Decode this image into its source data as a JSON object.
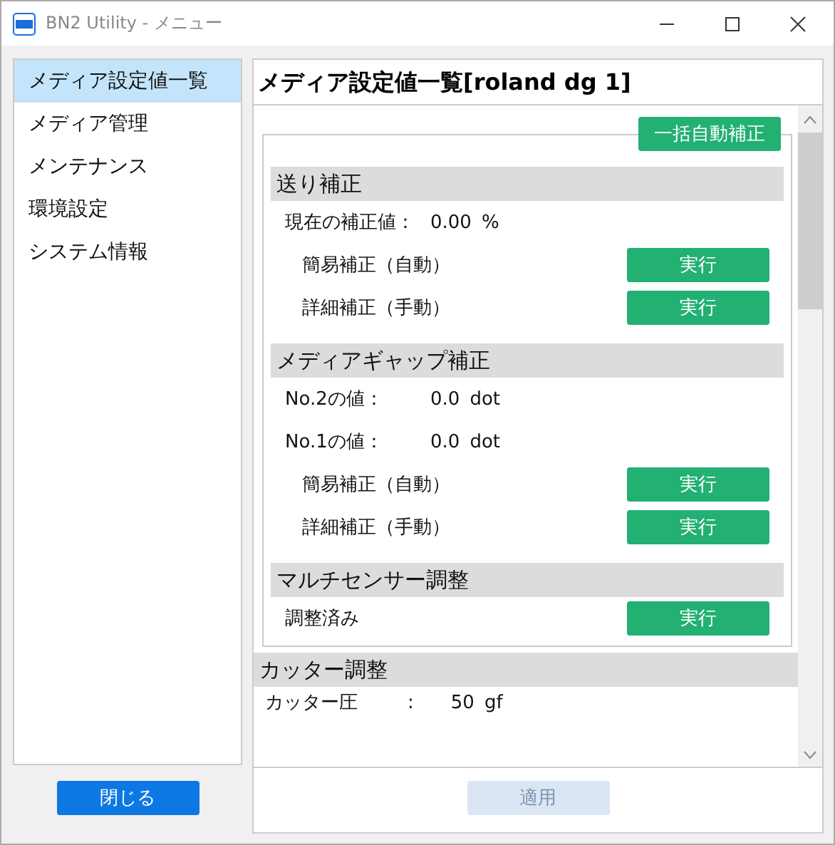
{
  "window": {
    "title": "BN2 Utility - メニュー"
  },
  "sidebar": {
    "items": [
      {
        "label": "メディア設定値一覧",
        "selected": true
      },
      {
        "label": "メディア管理",
        "selected": false
      },
      {
        "label": "メンテナンス",
        "selected": false
      },
      {
        "label": "環境設定",
        "selected": false
      },
      {
        "label": "システム情報",
        "selected": false
      }
    ]
  },
  "close_button": "閉じる",
  "panel": {
    "title": "メディア設定値一覧[roland dg 1]",
    "bulk_button": "一括自動補正",
    "sections": [
      {
        "title": "送り補正",
        "rows": [
          {
            "kind": "value",
            "label": "現在の補正値：",
            "value": "0.00",
            "unit": "%"
          },
          {
            "kind": "action",
            "label": "簡易補正（自動）",
            "button": "実行"
          },
          {
            "kind": "action",
            "label": "詳細補正（手動）",
            "button": "実行"
          }
        ]
      },
      {
        "title": "メディアギャップ補正",
        "rows": [
          {
            "kind": "value",
            "label": "No.2の値：",
            "value": "0.0",
            "unit": "dot"
          },
          {
            "kind": "value",
            "label": "No.1の値：",
            "value": "0.0",
            "unit": "dot"
          },
          {
            "kind": "action",
            "label": "簡易補正（自動）",
            "button": "実行"
          },
          {
            "kind": "action",
            "label": "詳細補正（手動）",
            "button": "実行"
          }
        ]
      },
      {
        "title": "マルチセンサー調整",
        "rows": [
          {
            "kind": "status",
            "label": "調整済み",
            "button": "実行"
          }
        ]
      }
    ],
    "outer_sections": [
      {
        "title": "カッター調整",
        "rows": [
          {
            "kind": "value",
            "label": "カッター圧",
            "separator": ":",
            "value": "50",
            "unit": "gf"
          }
        ]
      }
    ],
    "apply_button": {
      "label": "適用",
      "disabled": true
    }
  }
}
